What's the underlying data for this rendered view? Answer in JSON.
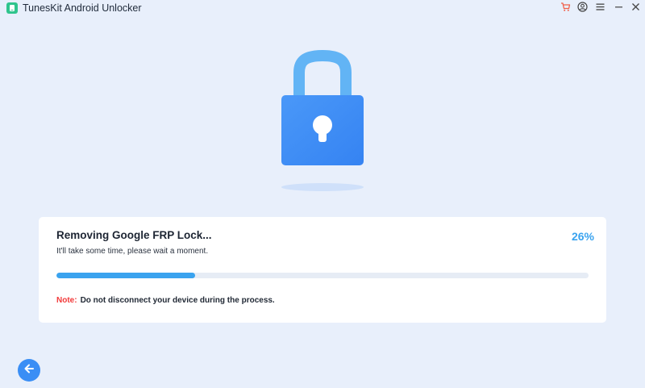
{
  "app": {
    "title": "TunesKit Android Unlocker",
    "brand_color": "#2fc48d"
  },
  "titlebar": {
    "buttons": [
      {
        "name": "cart-icon",
        "color": "#f0604a"
      },
      {
        "name": "account-icon",
        "color": "#444444"
      },
      {
        "name": "menu-icon",
        "color": "#444444"
      },
      {
        "name": "minimize-icon",
        "color": "#444444"
      },
      {
        "name": "close-icon",
        "color": "#444444"
      }
    ]
  },
  "hero": {
    "icon": "padlock-icon",
    "body_color": "#3f8ef6",
    "shackle_color": "#62b4f5"
  },
  "status": {
    "title": "Removing Google FRP Lock...",
    "subtitle": "It'll take some time, please wait a moment.",
    "progress_percent": 26,
    "progress_text": "26%",
    "accent_color": "#3aa3ef"
  },
  "note": {
    "label": "Note:",
    "text": "Do not disconnect your device during the process.",
    "label_color": "#f23a3a"
  },
  "back_button": {
    "icon": "arrow-left-icon",
    "color": "#3a8ef5"
  }
}
